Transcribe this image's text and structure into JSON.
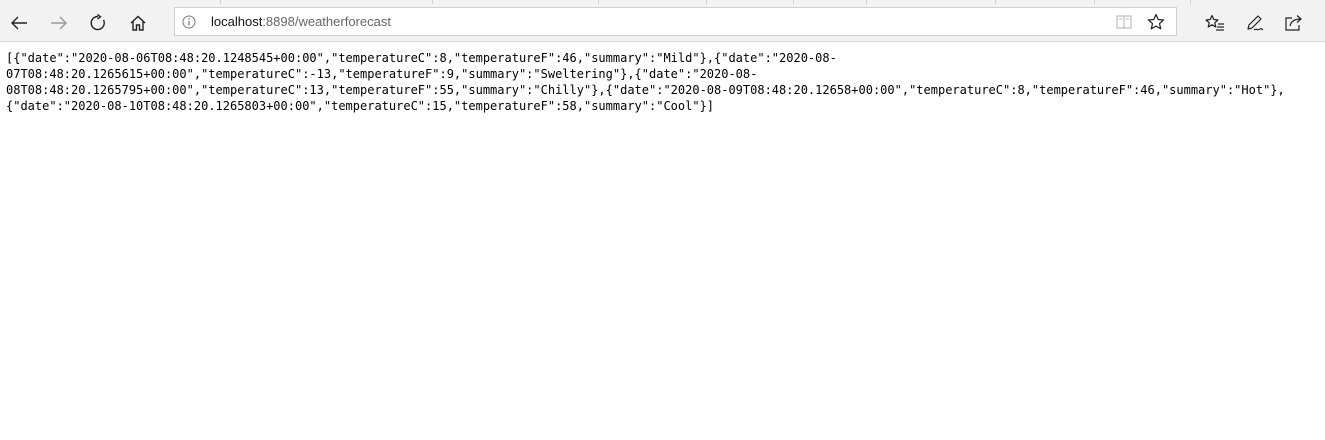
{
  "browser": {
    "address": {
      "host": "localhost",
      "rest": ":8898/weatherforecast"
    },
    "icons": {
      "back": "back-arrow-icon",
      "forward": "forward-arrow-icon",
      "refresh": "refresh-icon",
      "home": "home-icon",
      "info": "info-icon",
      "reading_view": "reading-view-icon",
      "favorite": "star-icon",
      "favorites_list": "favorites-list-icon",
      "pen": "pen-icon",
      "share": "share-icon"
    }
  },
  "page": {
    "json_lines": [
      "[{\"date\":\"2020-08-06T08:48:20.1248545+00:00\",\"temperatureC\":8,\"temperatureF\":46,\"summary\":\"Mild\"},{\"date\":\"2020-08-",
      "07T08:48:20.1265615+00:00\",\"temperatureC\":-13,\"temperatureF\":9,\"summary\":\"Sweltering\"},{\"date\":\"2020-08-",
      "08T08:48:20.1265795+00:00\",\"temperatureC\":13,\"temperatureF\":55,\"summary\":\"Chilly\"},{\"date\":\"2020-08-09T08:48:20.12658+00:00\",\"temperatureC\":8,\"temperatureF\":46,\"summary\":\"Hot\"},",
      "{\"date\":\"2020-08-10T08:48:20.1265803+00:00\",\"temperatureC\":15,\"temperatureF\":58,\"summary\":\"Cool\"}]"
    ]
  }
}
